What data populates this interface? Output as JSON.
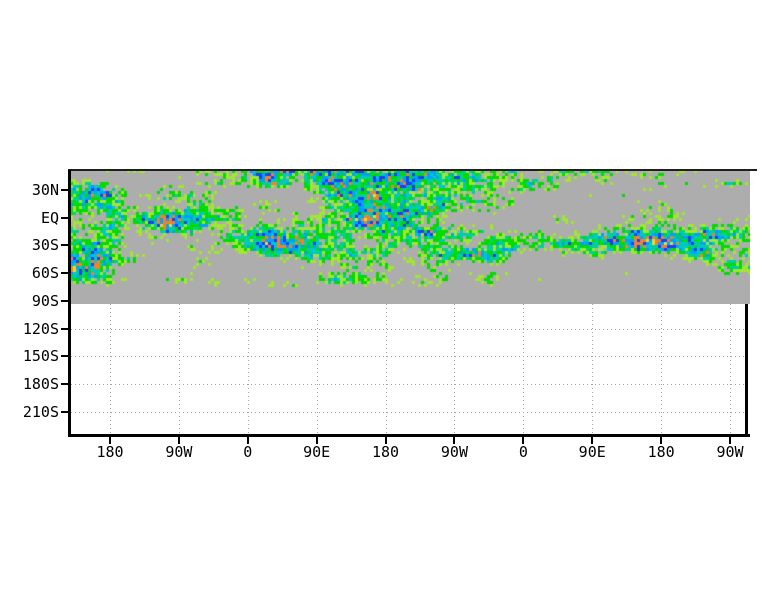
{
  "chart_data": {
    "type": "heatmap",
    "title": "",
    "x_axis": {
      "tick_labels": [
        "180",
        "90W",
        "0",
        "90E",
        "180",
        "90W",
        "0",
        "90E",
        "180",
        "90W"
      ],
      "note": "longitude axis wrapping through 2.5 cycles, 90-degree tick spacing"
    },
    "y_axis": {
      "tick_labels": [
        "30N",
        "EQ",
        "30S",
        "60S",
        "90S",
        "120S",
        "150S",
        "180S",
        "210S"
      ],
      "note": "30-degree tick spacing; plot extends from ~50N at top to ~240S at bottom frame"
    },
    "field": {
      "kind": "speckled shaded-grid anomaly band on gray background",
      "extent": "colored speckle filaments from plot top down to ~70S; solid gray continues to 90S; area below 90S is empty white with dotted gridlines",
      "background_color": "#adadad",
      "level_colors": {
        "weak_green": "#a0e632",
        "green": "#00dc00",
        "aqua": "#00d28c",
        "cyan": "#00c8c8",
        "light_blue": "#00a0ff",
        "dark_blue": "#1e3cff",
        "orange": "#f08228",
        "yellow": "#e6dc32"
      },
      "frame_color": "#000000",
      "gridline_color": "#a3a3a3"
    }
  }
}
